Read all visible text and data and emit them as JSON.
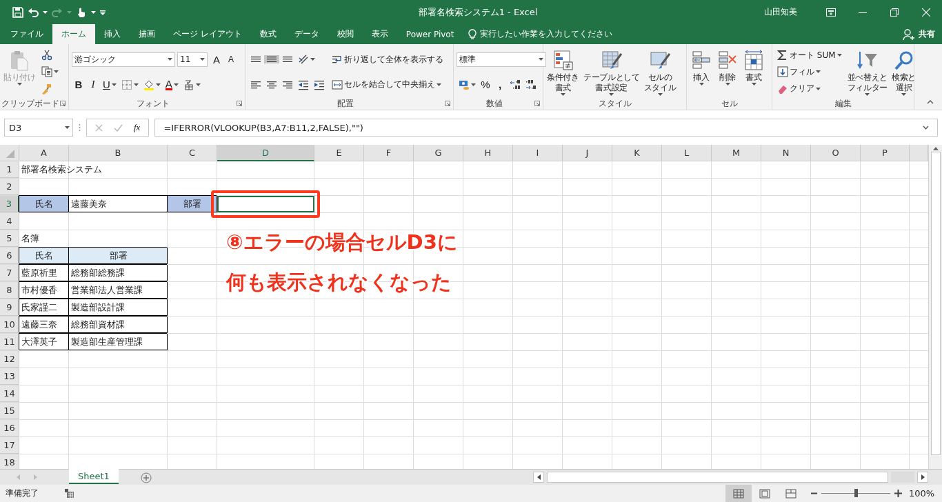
{
  "title_bar": {
    "title": "部署名検索システム1  -  Excel",
    "user": "山田知美"
  },
  "tabs": [
    {
      "label": "ファイル",
      "selected": false
    },
    {
      "label": "ホーム",
      "selected": true
    },
    {
      "label": "挿入",
      "selected": false
    },
    {
      "label": "描画",
      "selected": false
    },
    {
      "label": "ページ レイアウト",
      "selected": false
    },
    {
      "label": "数式",
      "selected": false
    },
    {
      "label": "データ",
      "selected": false
    },
    {
      "label": "校閲",
      "selected": false
    },
    {
      "label": "表示",
      "selected": false
    },
    {
      "label": "Power Pivot",
      "selected": false
    }
  ],
  "tell_me": "実行したい作業を入力してください",
  "share": "共有",
  "ribbon": [
    {
      "label": "クリップボード",
      "launcher": true,
      "columns": [
        [
          [
            {
              "kind": "large",
              "lines": [
                "貼り付け"
              ],
              "dropdown": true,
              "disabled": true
            }
          ]
        ],
        [
          [
            {
              "kind": "icon"
            }
          ],
          [
            {
              "kind": "icon",
              "dropdown": true
            }
          ],
          [
            {
              "kind": "icon"
            }
          ]
        ]
      ]
    },
    {
      "label": "フォント",
      "launcher": true,
      "columns": [
        [
          [
            {
              "kind": "font_combo",
              "value": "游ゴシック"
            },
            {
              "kind": "size_combo",
              "value": "11"
            },
            {
              "kind": "glyph",
              "text": "A"
            },
            {
              "kind": "glyph_small",
              "text": "A"
            }
          ],
          [
            {
              "kind": "bold",
              "text": "B"
            },
            {
              "kind": "italic",
              "text": "I"
            },
            {
              "kind": "underline",
              "text": "U",
              "dropdown": true
            },
            {
              "kind": "icon",
              "dropdown": true
            },
            {
              "kind": "icon",
              "dropdown": true
            },
            {
              "kind": "font_color",
              "text": "A",
              "dropdown": true
            },
            {
              "kind": "icon",
              "dropdown": true
            }
          ]
        ]
      ]
    },
    {
      "label": "配置",
      "launcher": true,
      "columns": [
        [
          [
            {
              "kind": "icon",
              "on": false
            },
            {
              "kind": "icon",
              "on": true
            },
            {
              "kind": "icon",
              "on": false
            },
            {
              "kind": "icon",
              "dropdown": true,
              "on": false
            }
          ],
          [
            {
              "kind": "icon",
              "on": false
            },
            {
              "kind": "icon",
              "on": false
            },
            {
              "kind": "icon",
              "on": false
            },
            {
              "kind": "icon",
              "on": false
            },
            {
              "kind": "icon",
              "on": false
            }
          ]
        ],
        [
          [
            {
              "kind": "small",
              "label": "折り返して全体を表示する"
            }
          ],
          [
            {
              "kind": "small",
              "label": "セルを結合して中央揃え",
              "dropdown": true
            }
          ]
        ]
      ]
    },
    {
      "label": "数値",
      "launcher": true,
      "columns": [
        [
          [
            {
              "kind": "format_combo",
              "value": "標準"
            }
          ],
          [
            {
              "kind": "icon",
              "dropdown": true
            },
            {
              "kind": "glyph",
              "text": "%"
            },
            {
              "kind": "bold",
              "text": ","
            },
            {
              "kind": "icon"
            },
            {
              "kind": "icon"
            }
          ]
        ]
      ]
    },
    {
      "label": "スタイル",
      "launcher": false,
      "columns": [
        [
          [
            {
              "kind": "large",
              "lines": [
                "条件付き",
                "書式"
              ],
              "dropdown": true
            }
          ]
        ],
        [
          [
            {
              "kind": "large",
              "lines": [
                "テーブルとして",
                "書式設定"
              ],
              "dropdown": true
            }
          ]
        ],
        [
          [
            {
              "kind": "large",
              "lines": [
                "セルの",
                "スタイル"
              ],
              "dropdown": true
            }
          ]
        ]
      ]
    },
    {
      "label": "セル",
      "launcher": false,
      "columns": [
        [
          [
            {
              "kind": "large",
              "lines": [
                "挿入"
              ],
              "dropdown": true
            }
          ]
        ],
        [
          [
            {
              "kind": "large",
              "lines": [
                "削除"
              ],
              "dropdown": true
            }
          ]
        ],
        [
          [
            {
              "kind": "large",
              "lines": [
                "書式"
              ],
              "dropdown": true
            }
          ]
        ]
      ]
    },
    {
      "label": "編集",
      "launcher": false,
      "columns": [
        [
          [
            {
              "kind": "small",
              "label": "オート SUM",
              "dropdown": true
            }
          ],
          [
            {
              "kind": "small",
              "label": "フィル",
              "dropdown": true
            }
          ],
          [
            {
              "kind": "small",
              "label": "クリア",
              "dropdown": true
            }
          ]
        ],
        [
          [
            {
              "kind": "large",
              "lines": [
                "並べ替えと",
                "フィルター"
              ],
              "dropdown": true
            }
          ]
        ],
        [
          [
            {
              "kind": "large",
              "lines": [
                "検索と",
                "選択"
              ],
              "dropdown": true
            }
          ]
        ]
      ]
    }
  ],
  "formula_bar": {
    "name_box": "D3",
    "function_label": "fx",
    "formula": "=IFERROR(VLOOKUP(B3,A7:B11,2,FALSE),\"\")"
  },
  "sheet": {
    "columns": [
      {
        "label": "A",
        "selected": false
      },
      {
        "label": "B",
        "selected": false
      },
      {
        "label": "C",
        "selected": false
      },
      {
        "label": "D",
        "selected": true
      },
      {
        "label": "E",
        "selected": false
      },
      {
        "label": "F",
        "selected": false
      },
      {
        "label": "G",
        "selected": false
      },
      {
        "label": "H",
        "selected": false
      },
      {
        "label": "I",
        "selected": false
      },
      {
        "label": "J",
        "selected": false
      },
      {
        "label": "K",
        "selected": false
      },
      {
        "label": "L",
        "selected": false
      },
      {
        "label": "M",
        "selected": false
      },
      {
        "label": "N",
        "selected": false
      },
      {
        "label": "O",
        "selected": false
      },
      {
        "label": "P",
        "selected": false
      }
    ],
    "rows": [
      {
        "label": "1",
        "selected": false,
        "cells": [
          {
            "kind": "text",
            "text": "部署名検索システム"
          }
        ]
      },
      {
        "label": "2",
        "selected": false,
        "cells": []
      },
      {
        "label": "3",
        "selected": true,
        "cells": [
          {
            "kind": "label",
            "text": "氏名"
          },
          {
            "kind": "entry",
            "text": "遠藤美奈"
          },
          {
            "kind": "label",
            "text": "部署"
          }
        ]
      },
      {
        "label": "4",
        "selected": false,
        "cells": []
      },
      {
        "label": "5",
        "selected": false,
        "cells": [
          {
            "kind": "text",
            "text": "名簿"
          }
        ]
      },
      {
        "label": "6",
        "selected": false,
        "cells": [
          {
            "kind": "header",
            "text": "氏名"
          },
          {
            "kind": "header",
            "text": "部署"
          }
        ]
      },
      {
        "label": "7",
        "selected": false,
        "cells": [
          {
            "kind": "entry",
            "text": "藍原祈里"
          },
          {
            "kind": "entry",
            "text": "総務部総務課"
          }
        ]
      },
      {
        "label": "8",
        "selected": false,
        "cells": [
          {
            "kind": "entry",
            "text": "市村優香"
          },
          {
            "kind": "entry",
            "text": "営業部法人営業課"
          }
        ]
      },
      {
        "label": "9",
        "selected": false,
        "cells": [
          {
            "kind": "entry",
            "text": "氏家謹二"
          },
          {
            "kind": "entry",
            "text": "製造部設計課"
          }
        ]
      },
      {
        "label": "10",
        "selected": false,
        "cells": [
          {
            "kind": "entry",
            "text": "遠藤三奈"
          },
          {
            "kind": "entry",
            "text": "総務部資材課"
          }
        ]
      },
      {
        "label": "11",
        "selected": false,
        "cells": [
          {
            "kind": "entry",
            "text": "大澤英子"
          },
          {
            "kind": "entry",
            "text": "製造部生産管理課"
          }
        ]
      },
      {
        "label": "12",
        "selected": false,
        "cells": []
      },
      {
        "label": "13",
        "selected": false,
        "cells": []
      },
      {
        "label": "14",
        "selected": false,
        "cells": []
      },
      {
        "label": "15",
        "selected": false,
        "cells": []
      },
      {
        "label": "16",
        "selected": false,
        "cells": []
      },
      {
        "label": "17",
        "selected": false,
        "cells": []
      },
      {
        "label": "18",
        "selected": false,
        "cells": []
      }
    ]
  },
  "callout": {
    "lines": [
      "⑧エラーの場合セルD3に",
      "何も表示されなくなった"
    ]
  },
  "sheet_tabs": [
    {
      "label": "Sheet1",
      "selected": true
    }
  ],
  "status_bar": {
    "status": "準備完了",
    "views": [
      {
        "selected": true
      },
      {
        "selected": false
      },
      {
        "selected": false
      }
    ],
    "zoom": {
      "level": 0.5
    },
    "zoom_label": "100%"
  }
}
